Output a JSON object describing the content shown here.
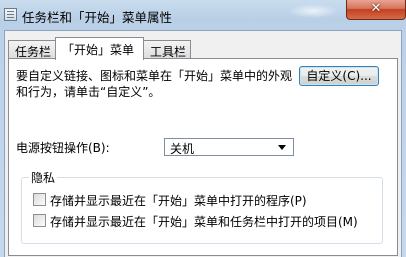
{
  "window": {
    "title": "任务栏和「开始」菜单属性",
    "close_symbol": "✕"
  },
  "tabs": [
    {
      "label": "任务栏",
      "active": false
    },
    {
      "label": "「开始」菜单",
      "active": true
    },
    {
      "label": "工具栏",
      "active": false
    }
  ],
  "panel": {
    "description": "要自定义链接、图标和菜单在「开始」菜单中的外观和行为，请单击“自定义”。",
    "customize_button": "自定义(C)...",
    "power_label": "电源按钮操作(B):",
    "power_value": "关机"
  },
  "privacy": {
    "title": "隐私",
    "options": [
      {
        "label": "存储并显示最近在「开始」菜单中打开的程序(P)",
        "checked": false
      },
      {
        "label": "存储并显示最近在「开始」菜单和任务栏中打开的项目(M)",
        "checked": false
      }
    ]
  }
}
